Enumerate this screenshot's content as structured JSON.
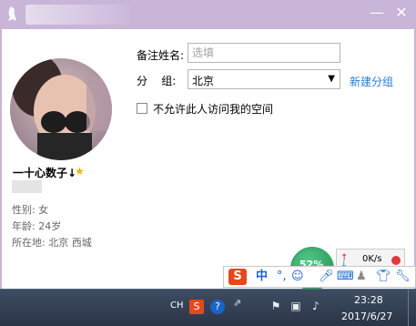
{
  "window": {
    "minimize_glyph": "—",
    "close_glyph": "✕"
  },
  "profile": {
    "nickname": "一十心数子↓",
    "info": {
      "gender": "性别: 女",
      "age": "年龄: 24岁",
      "location": "所在地: 北京  西城"
    }
  },
  "form": {
    "remark_label": "备注姓名:",
    "remark_placeholder": "选填",
    "group_label": "分    组:",
    "group_value": "北京",
    "new_group_link": "新建分组",
    "privacy_checkbox_label": "不允许此人访问我的空间",
    "privacy_checked": false
  },
  "network_widget": {
    "percent": "52%",
    "speed": "0K/s"
  },
  "ime_toolbar": {
    "logo": "S",
    "mode": "中",
    "punct": "°,"
  },
  "taskbar": {
    "lang": "CH",
    "time": "23:28",
    "date": "2017/6/27"
  },
  "colors": {
    "titlebar": "#c9b5d8",
    "link": "#2a7cd0",
    "star": "#f0b400",
    "sogou": "#e8471c"
  }
}
